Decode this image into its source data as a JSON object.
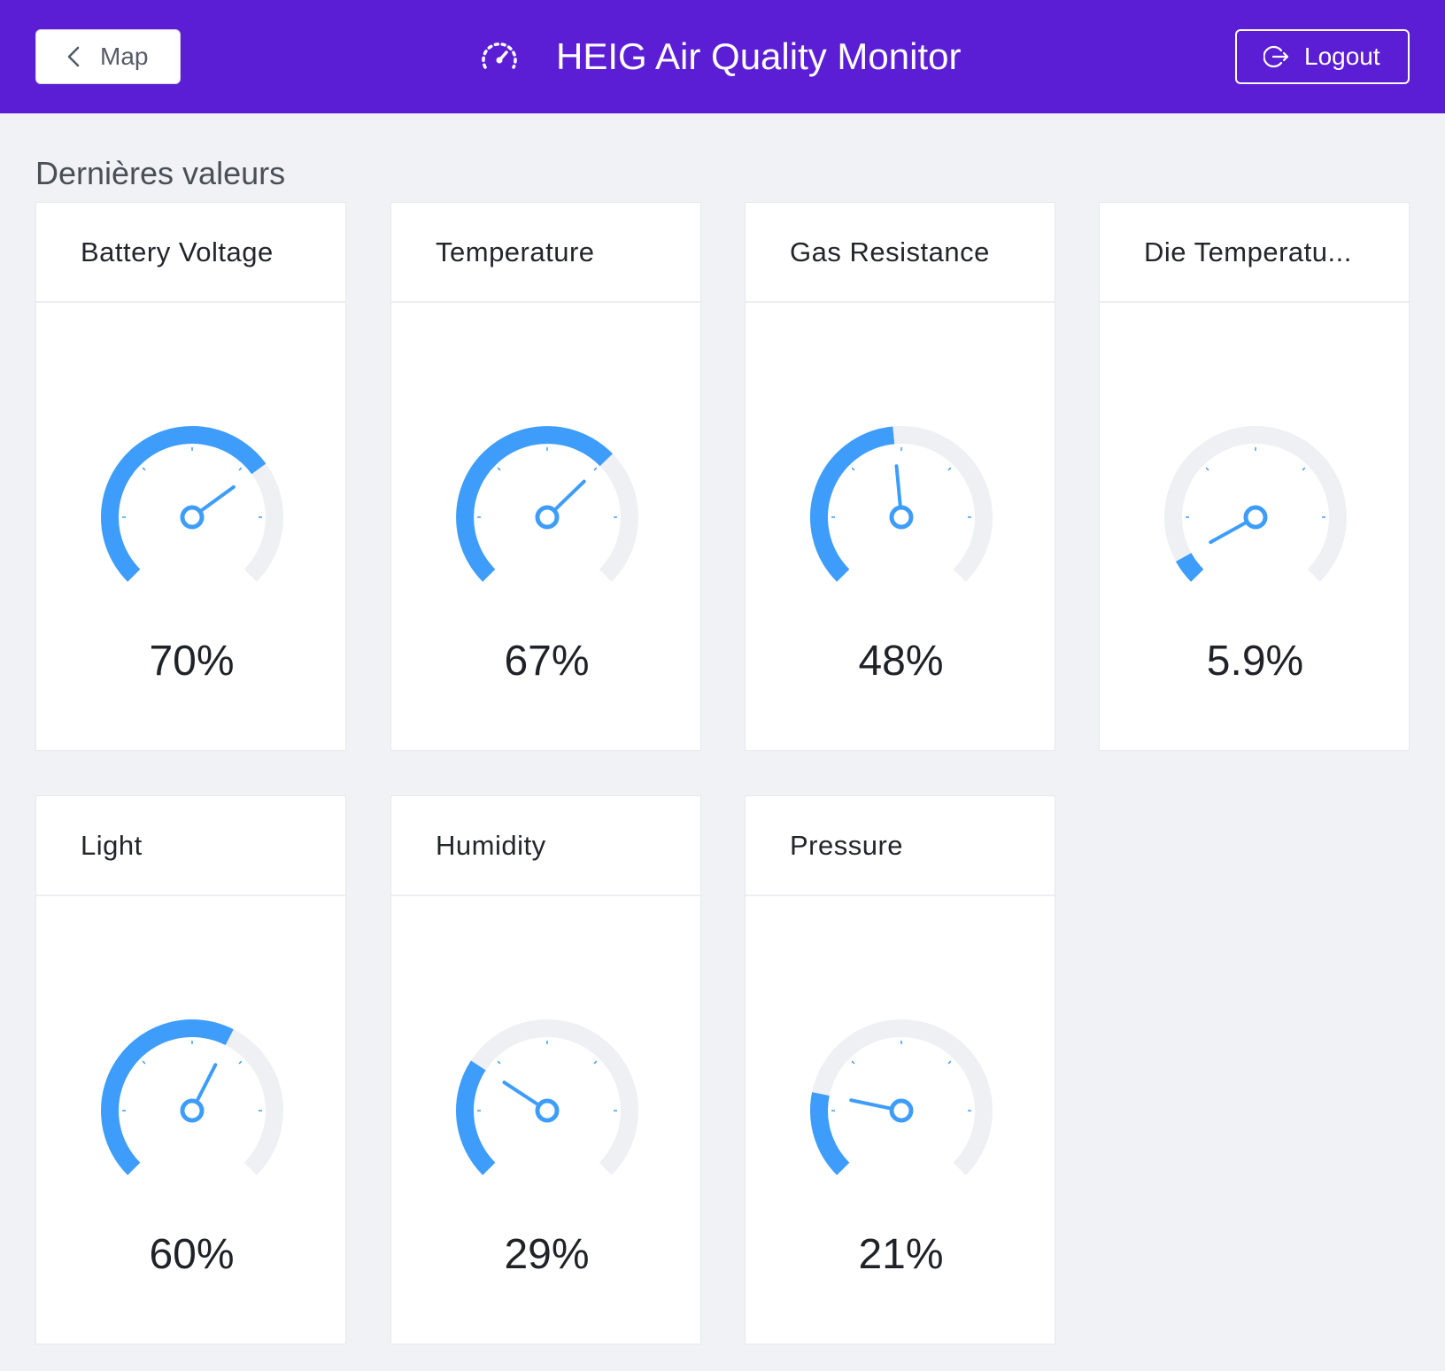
{
  "header": {
    "back_label": "Map",
    "title": "HEIG Air Quality Monitor",
    "logout_label": "Logout",
    "background": "#5b1ed5"
  },
  "section": {
    "title": "Dernières valeurs"
  },
  "colors": {
    "gauge_fill": "#3e9dfa",
    "gauge_track": "#eef0f3"
  },
  "cards": [
    {
      "title": "Battery Voltage",
      "percent": 70,
      "value_label": "70%"
    },
    {
      "title": "Temperature",
      "percent": 67,
      "value_label": "67%"
    },
    {
      "title": "Gas Resistance",
      "percent": 48,
      "value_label": "48%"
    },
    {
      "title": "Die Temperatu...",
      "percent": 5.9,
      "value_label": "5.9%"
    },
    {
      "title": "Light",
      "percent": 60,
      "value_label": "60%"
    },
    {
      "title": "Humidity",
      "percent": 29,
      "value_label": "29%"
    },
    {
      "title": "Pressure",
      "percent": 21,
      "value_label": "21%"
    }
  ]
}
